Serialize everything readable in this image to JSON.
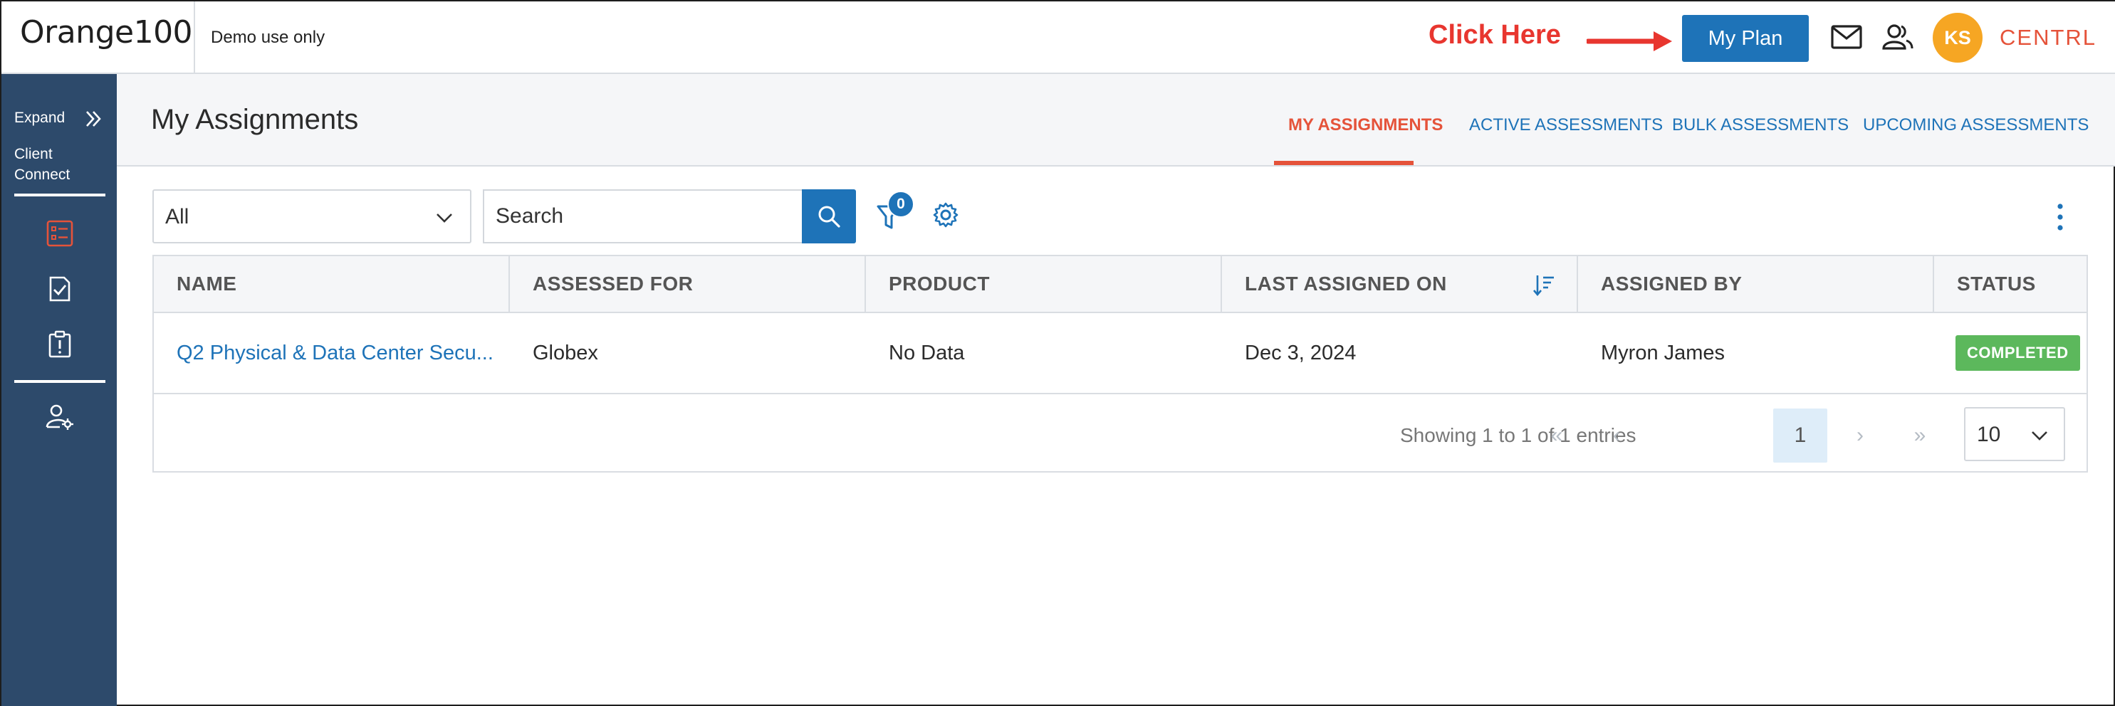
{
  "header": {
    "brand": "Orange100",
    "tagline": "Demo use only",
    "annotation": "Click Here",
    "plan_button": "My Plan",
    "avatar_initials": "KS",
    "company": "CENTRL",
    "icons": [
      "mail-icon",
      "users-icon"
    ]
  },
  "sidebar": {
    "expand_label": "Expand",
    "section_label": "Client Connect",
    "items": [
      {
        "name": "assignments-list-icon",
        "active": true
      },
      {
        "name": "check-document-icon",
        "active": false
      },
      {
        "name": "alert-clipboard-icon",
        "active": false
      },
      {
        "name": "user-settings-icon",
        "active": false
      }
    ]
  },
  "page": {
    "title": "My Assignments",
    "tabs": [
      {
        "label": "MY ASSIGNMENTS",
        "active": true
      },
      {
        "label": "ACTIVE ASSESSMENTS",
        "active": false
      },
      {
        "label": "BULK ASSESSMENTS",
        "active": false
      },
      {
        "label": "UPCOMING ASSESSMENTS",
        "active": false
      }
    ]
  },
  "toolbar": {
    "filter_select": "All",
    "search_placeholder": "Search",
    "filter_count": "0"
  },
  "table": {
    "columns": [
      "NAME",
      "ASSESSED FOR",
      "PRODUCT",
      "LAST ASSIGNED ON",
      "ASSIGNED BY",
      "STATUS"
    ],
    "rows": [
      {
        "name": "Q2 Physical & Data Center Secu...",
        "assessed_for": "Globex",
        "product": "No Data",
        "last_assigned_on": "Dec 3, 2024",
        "assigned_by": "Myron James",
        "status": "COMPLETED"
      }
    ]
  },
  "pagination": {
    "summary": "Showing 1 to 1 of 1 entries",
    "first": "«",
    "prev": "‹",
    "current_page": "1",
    "next": "›",
    "last": "»",
    "page_size": "10"
  },
  "colors": {
    "primary": "#1e73b8",
    "accent": "#e5533a",
    "sidebar": "#2d4a6b",
    "avatar": "#f6a623",
    "status_completed": "#5cb85c"
  }
}
